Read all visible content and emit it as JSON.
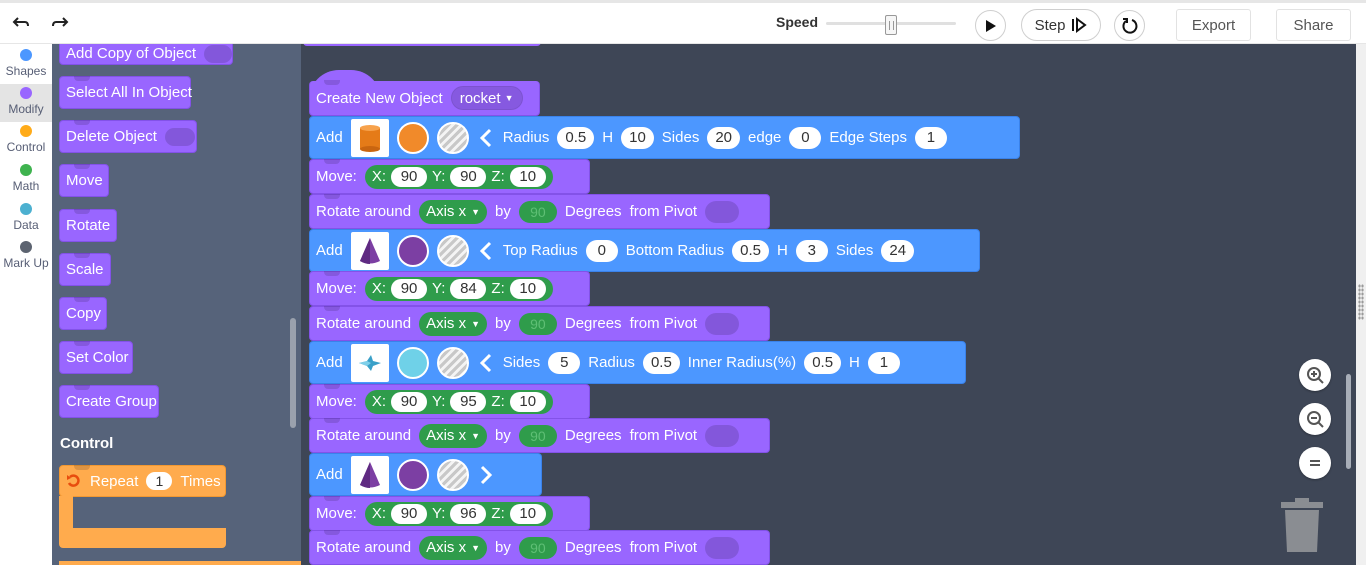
{
  "toolbar": {
    "undo_icon": "undo-arrow-icon",
    "redo_icon": "redo-arrow-icon",
    "speed_label": "Speed",
    "speed_value": 0.5,
    "play_icon": "play-icon",
    "step_label": "Step",
    "step_icon": "step-forward-icon",
    "reset_icon": "reset-icon",
    "export_label": "Export",
    "share_label": "Share"
  },
  "categories": [
    {
      "label": "Shapes",
      "color": "#4c97ff",
      "active": false
    },
    {
      "label": "Modify",
      "color": "#9966ff",
      "active": true
    },
    {
      "label": "Control",
      "color": "#ffab19",
      "active": false
    },
    {
      "label": "Math",
      "color": "#3fb34f",
      "active": false
    },
    {
      "label": "Data",
      "color": "#4cb0d0",
      "active": false
    },
    {
      "label": "Mark Up",
      "color": "#5c6370",
      "active": false
    }
  ],
  "flyout": {
    "blocks": [
      {
        "label": "Add Copy of Object",
        "slot": true
      },
      {
        "label": "Select All In Object",
        "slot": false
      },
      {
        "label": "Delete Object",
        "slot": true
      },
      {
        "label": "Move",
        "slot": false
      },
      {
        "label": "Rotate",
        "slot": false
      },
      {
        "label": "Scale",
        "slot": false
      },
      {
        "label": "Copy",
        "slot": false
      },
      {
        "label": "Set Color",
        "slot": false
      },
      {
        "label": "Create Group",
        "slot": false
      }
    ],
    "control_heading": "Control",
    "repeat": {
      "label": "Repeat",
      "count": "1",
      "suffix": "Times",
      "icon": "repeat-icon"
    }
  },
  "workspace": {
    "create_object": {
      "label": "Create New Object",
      "name": "rocket"
    },
    "add_label": "Add",
    "move_label": "Move:",
    "rotate_label": "Rotate around",
    "axis_label": "Axis x",
    "by_label": "by",
    "degrees_value": "90",
    "degrees_label": "Degrees",
    "pivot_label": "from Pivot",
    "x_label": "X:",
    "y_label": "Y:",
    "z_label": "Z:",
    "shapes": [
      {
        "icon": "cylinder-icon",
        "color": "#f18a2a",
        "params": [
          {
            "label": "Radius",
            "value": "0.5"
          },
          {
            "label": "H",
            "value": "10"
          },
          {
            "label": "Sides",
            "value": "20"
          },
          {
            "label": "edge",
            "value": "0"
          },
          {
            "label": "Edge Steps",
            "value": "1"
          }
        ],
        "move": {
          "x": "90",
          "y": "90",
          "z": "10"
        }
      },
      {
        "icon": "cone-icon",
        "color": "#7c3fa3",
        "params": [
          {
            "label": "Top Radius",
            "value": "0"
          },
          {
            "label": "Bottom Radius",
            "value": "0.5"
          },
          {
            "label": "H",
            "value": "3"
          },
          {
            "label": "Sides",
            "value": "24"
          }
        ],
        "move": {
          "x": "90",
          "y": "84",
          "z": "10"
        }
      },
      {
        "icon": "star-icon",
        "color": "#6fd1e8",
        "params": [
          {
            "label": "Sides",
            "value": "5"
          },
          {
            "label": "Radius",
            "value": "0.5"
          },
          {
            "label": "Inner Radius(%)",
            "value": "0.5"
          },
          {
            "label": "H",
            "value": "1"
          }
        ],
        "move": {
          "x": "90",
          "y": "95",
          "z": "10"
        }
      },
      {
        "icon": "cone-icon",
        "color": "#7c3fa3",
        "params": [],
        "move": {
          "x": "90",
          "y": "96",
          "z": "10"
        }
      }
    ]
  },
  "zoom": {
    "in_icon": "zoom-in-icon",
    "out_icon": "zoom-out-icon",
    "reset_icon": "zoom-reset-icon",
    "trash_icon": "trash-icon"
  }
}
